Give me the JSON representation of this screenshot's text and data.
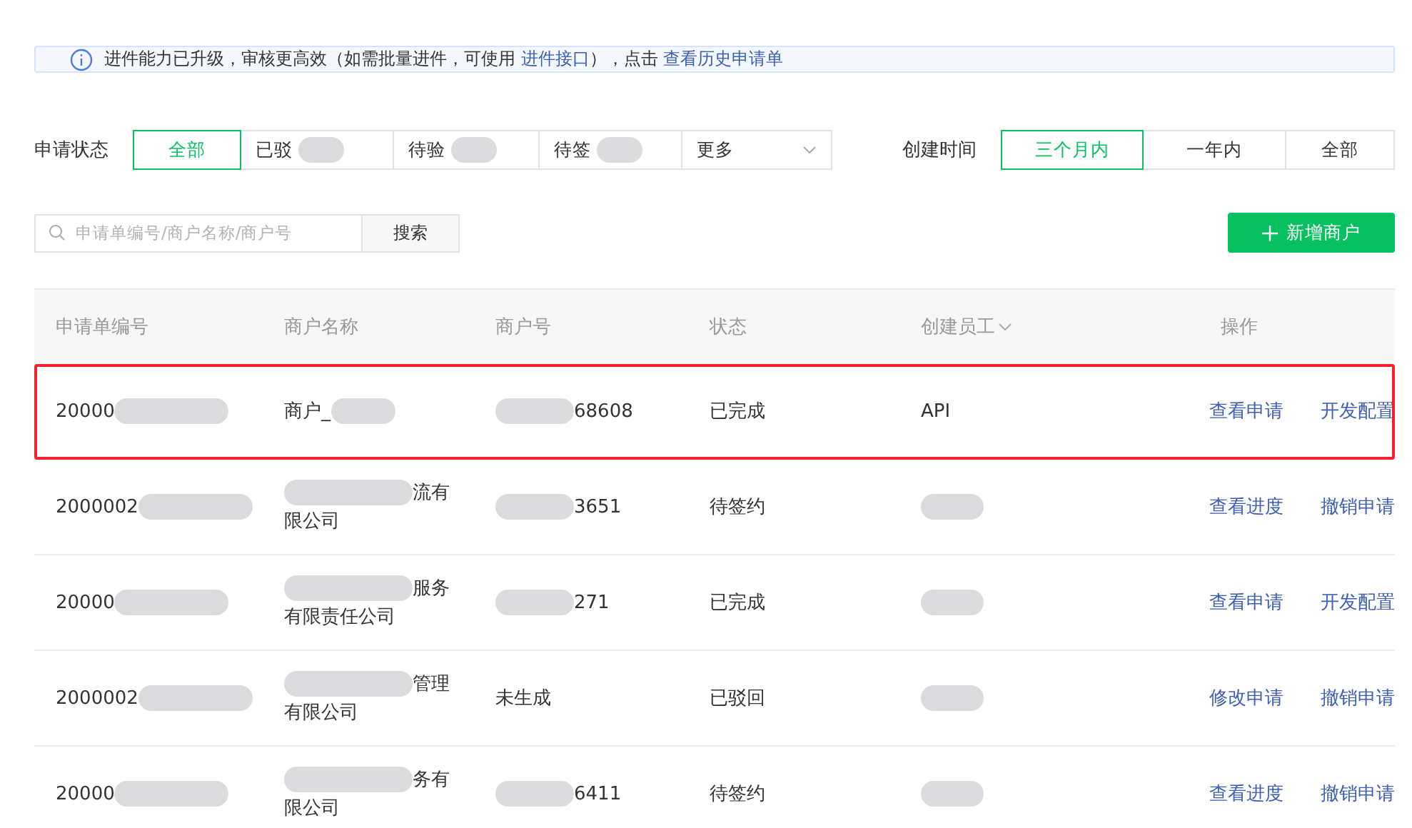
{
  "notice": {
    "text": "进件能力已升级，审核更高效（如需批量进件，可使用 ",
    "link1": "进件接口",
    "middle": "），点击 ",
    "link2": "查看历史申请单"
  },
  "status_filter": {
    "label": "申请状态",
    "options": [
      {
        "label": "全部",
        "selected": true,
        "blurred": false,
        "kind": "plain"
      },
      {
        "label": "已驳",
        "selected": false,
        "blurred": true,
        "kind": "plain"
      },
      {
        "label": "待验",
        "selected": false,
        "blurred": true,
        "kind": "plain"
      },
      {
        "label": "待签",
        "selected": false,
        "blurred": true,
        "kind": "plain"
      },
      {
        "label": "更多",
        "selected": false,
        "blurred": false,
        "kind": "dropdown"
      }
    ]
  },
  "time_filter": {
    "label": "创建时间",
    "options": [
      {
        "label": "三个月内",
        "selected": true
      },
      {
        "label": "一年内",
        "selected": false
      },
      {
        "label": "全部",
        "selected": false
      }
    ]
  },
  "search": {
    "placeholder": "申请单编号/商户名称/商户号",
    "button": "搜索"
  },
  "add_button": "新增商户",
  "table": {
    "columns": [
      "申请单编号",
      "商户名称",
      "商户号",
      "状态",
      "创建员工",
      "操作"
    ],
    "rows": [
      {
        "highlighted": true,
        "id": {
          "text": "20000",
          "blurred": true
        },
        "name": {
          "lines": [
            "商户_"
          ],
          "blurred": true
        },
        "merchant_no": {
          "text": "68608",
          "blurred": true
        },
        "status": "已完成",
        "staff": {
          "text": "API"
        },
        "actions": [
          "查看申请",
          "开发配置"
        ]
      },
      {
        "highlighted": false,
        "id": {
          "text": "2000002",
          "blurred": true
        },
        "name": {
          "lines": [
            "流有",
            "限公司"
          ],
          "blurred": true
        },
        "merchant_no": {
          "text": "3651",
          "blurred": true
        },
        "status": "待签约",
        "staff": {
          "blurred": true
        },
        "actions": [
          "查看进度",
          "撤销申请"
        ]
      },
      {
        "highlighted": false,
        "id": {
          "text": "20000",
          "blurred": true
        },
        "name": {
          "lines": [
            "服务",
            "有限责任公司"
          ],
          "blurred": true
        },
        "merchant_no": {
          "text": "271",
          "blurred": true
        },
        "status": "已完成",
        "staff": {
          "blurred": true
        },
        "actions": [
          "查看申请",
          "开发配置"
        ]
      },
      {
        "highlighted": false,
        "id": {
          "text": "2000002",
          "blurred": true
        },
        "name": {
          "lines": [
            "管理",
            "有限公司"
          ],
          "blurred": true
        },
        "merchant_no": {
          "text": "未生成"
        },
        "status": "已驳回",
        "staff": {
          "blurred": true
        },
        "actions": [
          "修改申请",
          "撤销申请"
        ]
      },
      {
        "highlighted": false,
        "id": {
          "text": "20000",
          "blurred": true
        },
        "name": {
          "lines": [
            "务有",
            "限公司"
          ],
          "blurred": true
        },
        "merchant_no": {
          "text": "6411",
          "blurred": true
        },
        "status": "待签约",
        "staff": {
          "blurred": true
        },
        "actions": [
          "查看进度",
          "撤销申请"
        ]
      }
    ]
  }
}
